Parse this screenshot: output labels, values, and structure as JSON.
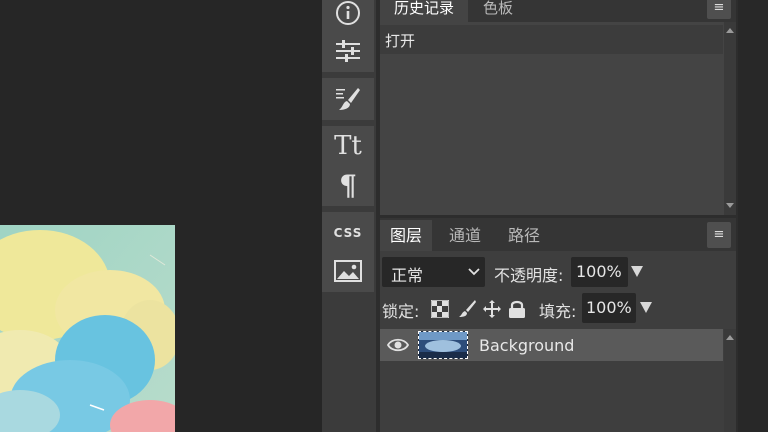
{
  "history_panel": {
    "tabs": [
      {
        "label": "历史记录"
      },
      {
        "label": "色板"
      }
    ],
    "menu_icon": "≡",
    "items": [
      {
        "label": "打开"
      }
    ]
  },
  "layers_panel": {
    "tabs": [
      {
        "label": "图层"
      },
      {
        "label": "通道"
      },
      {
        "label": "路径"
      }
    ],
    "menu_icon": "≡",
    "blend_mode": "正常",
    "opacity_label": "不透明度:",
    "opacity_value": "100%",
    "lock_label": "锁定:",
    "fill_label": "填充:",
    "fill_value": "100%",
    "layers": [
      {
        "name": "Background",
        "visible": true
      }
    ]
  },
  "toolbar": {
    "groups": [
      [
        "info-icon",
        "adjustments-icon"
      ],
      [
        "brush-settings-icon"
      ],
      [
        "character-icon",
        "paragraph-icon"
      ],
      [
        "css-icon",
        "image-icon"
      ]
    ],
    "css_label": "CSS",
    "char_label": "Tt",
    "para_label": "¶"
  },
  "colors": {
    "app_bg": "#252525",
    "panel_bg": "#444444",
    "tab_bar_bg": "#353535",
    "field_bg": "#272727",
    "selected_row": "#5a5a5a"
  }
}
